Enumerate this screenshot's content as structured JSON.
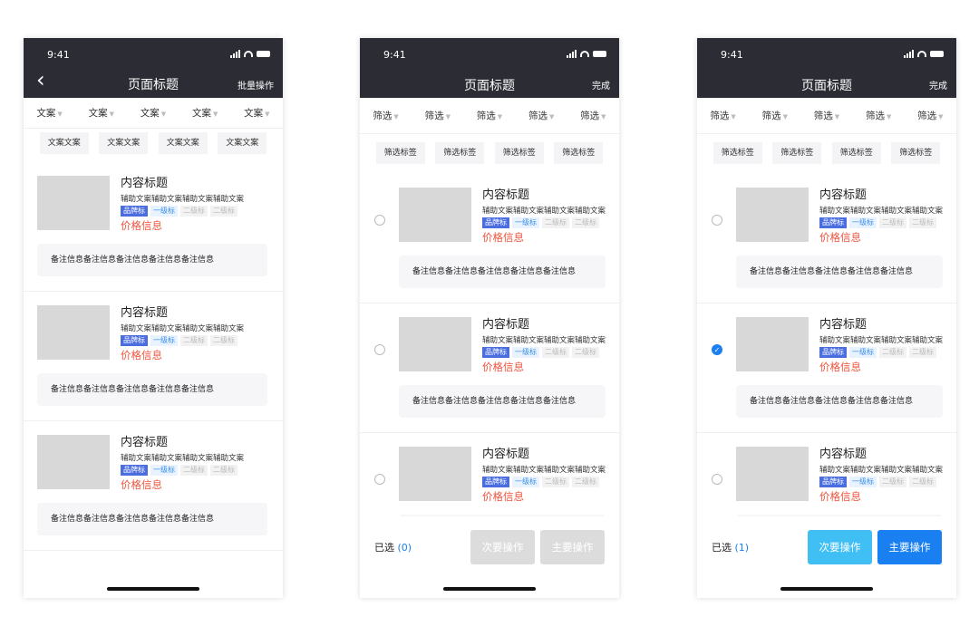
{
  "colors": {
    "header": "#2b2c34",
    "accent": "#1a7ff0",
    "price": "#f0533c",
    "disabled": "#dcdcdc",
    "secondary": "#40bff5"
  },
  "status": {
    "time": "9:41"
  },
  "item": {
    "title": "内容标题",
    "subtitle": "辅助文案辅助文案辅助文案辅助文案",
    "badges": [
      "品牌标",
      "一级标",
      "二级标",
      "二级标"
    ],
    "price": "价格信息",
    "note": "备注信息备注信息备注信息备注信息备注信息"
  },
  "screens": [
    {
      "title": "页面标题",
      "action": "批量操作",
      "back_icon": "chevron-left-icon",
      "filters": [
        "文案",
        "文案",
        "文案",
        "文案",
        "文案"
      ],
      "tags": [
        "文案文案",
        "文案文案",
        "文案文案",
        "文案文案"
      ]
    },
    {
      "title": "页面标题",
      "action": "完成",
      "filters": [
        "筛选",
        "筛选",
        "筛选",
        "筛选",
        "筛选"
      ],
      "tags": [
        "筛选标签",
        "筛选标签",
        "筛选标签",
        "筛选标签"
      ],
      "selected_label": "已选",
      "selected_count": "(0)",
      "selected": [
        false,
        false,
        false
      ],
      "secondary": "次要操作",
      "primary": "主要操作",
      "buttons_enabled": false
    },
    {
      "title": "页面标题",
      "action": "完成",
      "filters": [
        "筛选",
        "筛选",
        "筛选",
        "筛选",
        "筛选"
      ],
      "tags": [
        "筛选标签",
        "筛选标签",
        "筛选标签",
        "筛选标签"
      ],
      "selected_label": "已选",
      "selected_count": "(1)",
      "selected": [
        false,
        true,
        false
      ],
      "secondary": "次要操作",
      "primary": "主要操作",
      "buttons_enabled": true
    }
  ]
}
